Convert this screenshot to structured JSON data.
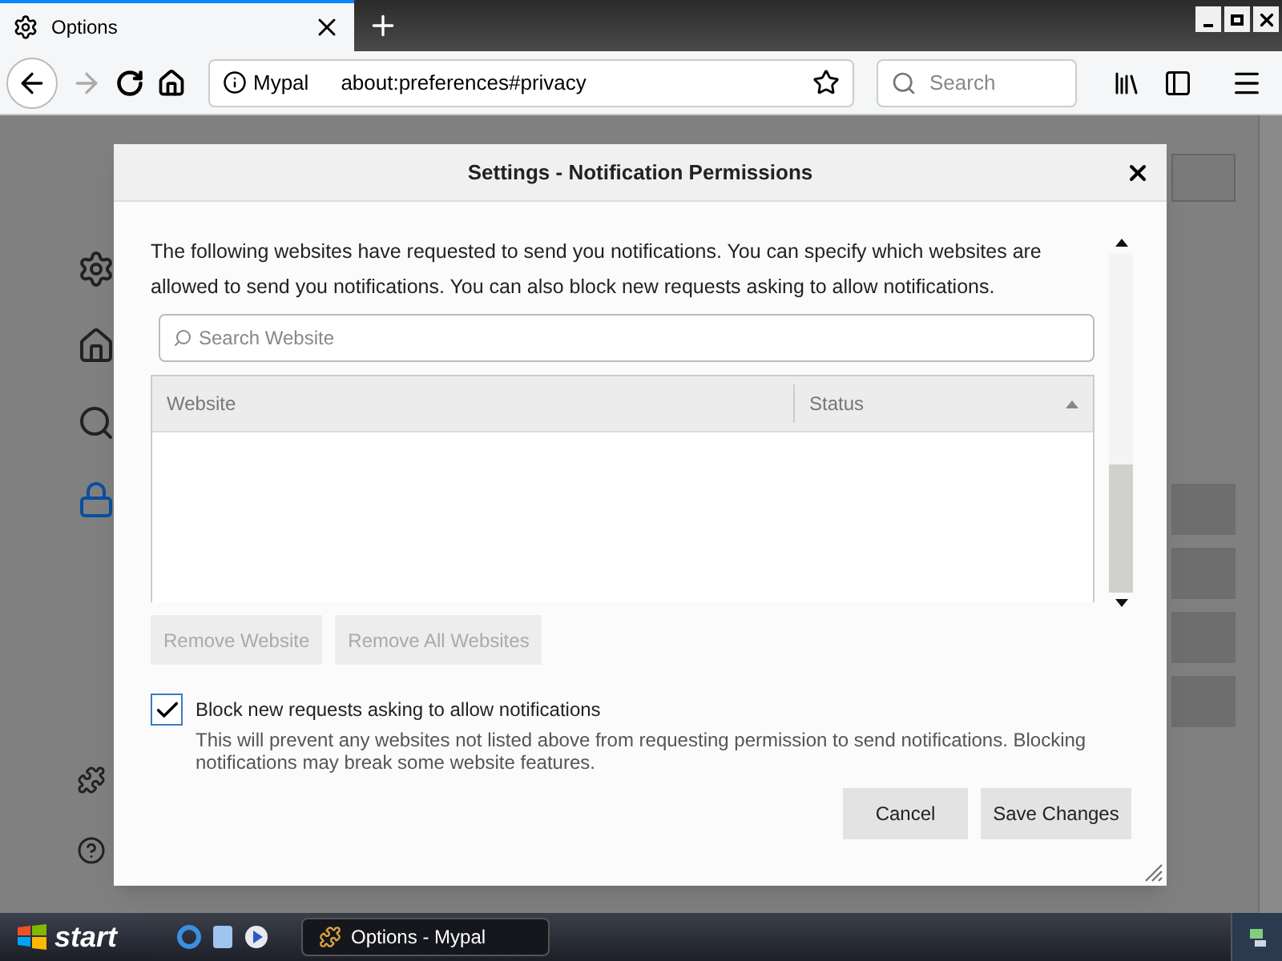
{
  "browser": {
    "tab": {
      "title": "Options",
      "selected": true
    },
    "url_identity": "Mypal",
    "url": "about:preferences#privacy",
    "search": {
      "placeholder": "Search"
    }
  },
  "dialog": {
    "title": "Settings - Notification Permissions",
    "description": "The following websites have requested to send you notifications. You can specify which websites are allowed to send you notifications. You can also block new requests asking to allow notifications.",
    "search": {
      "placeholder": "Search Website"
    },
    "table": {
      "columns": [
        "Website",
        "Status"
      ]
    },
    "list_buttons": [
      {
        "label": "Remove Website",
        "disabled": true
      },
      {
        "label": "Remove All Websites",
        "disabled": true
      }
    ],
    "block_option": {
      "label": "Block new requests asking to allow notifications",
      "checked": true,
      "note": "This will prevent any websites not listed above from requesting permission to send notifications. Blocking notifications may break some website features."
    },
    "buttons": [
      "Cancel",
      "Save Changes"
    ]
  },
  "taskbar": {
    "start": "start",
    "tasks": [
      {
        "label": "Options - Mypal",
        "selected": true
      }
    ]
  }
}
